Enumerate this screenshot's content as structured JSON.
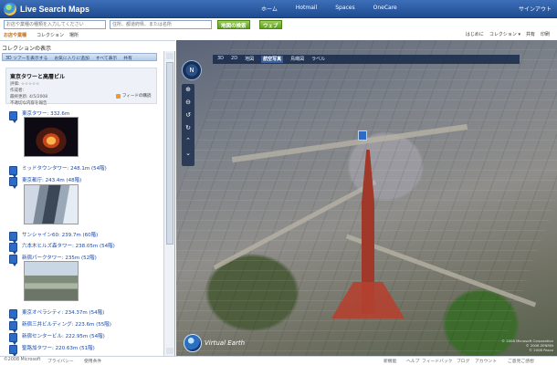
{
  "header": {
    "app_title": "Live Search Maps",
    "nav": [
      "ホーム",
      "Hotmail",
      "Spaces",
      "OneCare"
    ],
    "signout": "サインアウト"
  },
  "search": {
    "what_placeholder": "お店や業種の種類を入力してください",
    "where_placeholder": "住所、都道府県、または名所",
    "what_button": "地図の検索",
    "web_button": "ウェブ"
  },
  "tools": {
    "left": [
      "お店や業種",
      "コレクション",
      "場所"
    ],
    "right": [
      "はじめに",
      "コレクション ▾",
      "共有",
      "印刷"
    ]
  },
  "panel": {
    "heading": "コレクションの表示",
    "tabs": [
      "3D ツアーを表示する",
      "お気に入りに追加",
      "すべて表示",
      "共有"
    ],
    "collection": {
      "title": "東京タワーと高層ビル",
      "rating_label": "評価:",
      "author": "作成者: ",
      "created": "最終更新: 4/5/2008",
      "report": "不適切な内容を報告",
      "feed": "フィードの購読"
    },
    "items": [
      "東京タワー: 332.6m",
      "ミッドタウンタワー: 248.1m (54階)",
      "東京都庁: 243.4m (48階)",
      "サンシャイン60: 239.7m (60階)",
      "六本木ヒルズ森タワー: 238.05m (54階)",
      "新宿パークタワー: 235m (52階)",
      "東京オペラシティ: 234.37m (54階)",
      "新宿三井ビルディング: 223.6m (55階)",
      "新宿センタービル: 222.95m (54階)",
      "聖路加タワー: 220.63m (51階)"
    ]
  },
  "map": {
    "toolbar": [
      "3D",
      "2D",
      "地図",
      "航空写真",
      "鳥瞰図",
      "ラベル"
    ],
    "active_mode": "航空写真",
    "compass_label": "N",
    "brand": "Virtual Earth",
    "copyright": "© 2008 Microsoft Corporation\n© 2008 ZENRIN\n© 2008 Pasco"
  },
  "footer": {
    "left": [
      "©2008 Microsoft",
      "プライバシー",
      "使用条件"
    ],
    "right": [
      "新機能",
      "ヘルプ",
      "フィードバック",
      "ブログ",
      "アカウント",
      "ご意見ご感想"
    ]
  }
}
